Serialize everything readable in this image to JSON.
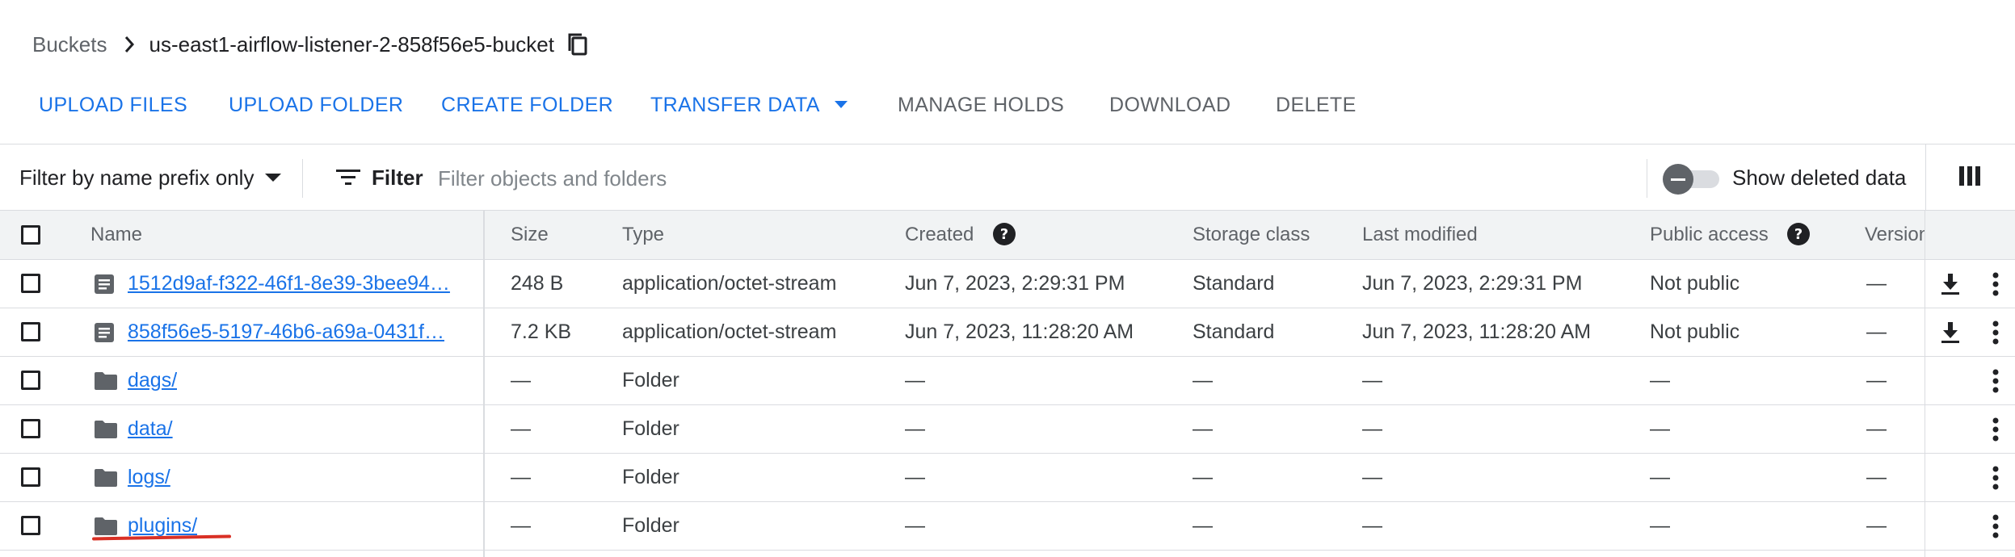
{
  "breadcrumb": {
    "root": "Buckets",
    "current": "us-east1-airflow-listener-2-858f56e5-bucket"
  },
  "toolbar": {
    "upload_files": "UPLOAD FILES",
    "upload_folder": "UPLOAD FOLDER",
    "create_folder": "CREATE FOLDER",
    "transfer_data": "TRANSFER DATA",
    "manage_holds": "MANAGE HOLDS",
    "download": "DOWNLOAD",
    "delete": "DELETE"
  },
  "filterbar": {
    "prefix_label": "Filter by name prefix only",
    "filter_label": "Filter",
    "filter_placeholder": "Filter objects and folders",
    "show_deleted_label": "Show deleted data"
  },
  "table": {
    "headers": {
      "name": "Name",
      "size": "Size",
      "type": "Type",
      "created": "Created",
      "storage_class": "Storage class",
      "last_modified": "Last modified",
      "public_access": "Public access",
      "version": "Version"
    },
    "rows": [
      {
        "name": "1512d9af-f322-46f1-8e39-3bee94…",
        "kind": "file",
        "size": "248 B",
        "type": "application/octet-stream",
        "created": "Jun 7, 2023, 2:29:31 PM",
        "storage_class": "Standard",
        "last_modified": "Jun 7, 2023, 2:29:31 PM",
        "public_access": "Not public",
        "version": "—"
      },
      {
        "name": "858f56e5-5197-46b6-a69a-0431f…",
        "kind": "file",
        "size": "7.2 KB",
        "type": "application/octet-stream",
        "created": "Jun 7, 2023, 11:28:20 AM",
        "storage_class": "Standard",
        "last_modified": "Jun 7, 2023, 11:28:20 AM",
        "public_access": "Not public",
        "version": "—"
      },
      {
        "name": "dags/",
        "kind": "folder",
        "size": "—",
        "type": "Folder",
        "created": "—",
        "storage_class": "—",
        "last_modified": "—",
        "public_access": "—",
        "version": "—"
      },
      {
        "name": "data/",
        "kind": "folder",
        "size": "—",
        "type": "Folder",
        "created": "—",
        "storage_class": "—",
        "last_modified": "—",
        "public_access": "—",
        "version": "—"
      },
      {
        "name": "logs/",
        "kind": "folder",
        "size": "—",
        "type": "Folder",
        "created": "—",
        "storage_class": "—",
        "last_modified": "—",
        "public_access": "—",
        "version": "—"
      },
      {
        "name": "plugins/",
        "kind": "folder",
        "size": "—",
        "type": "Folder",
        "created": "—",
        "storage_class": "—",
        "last_modified": "—",
        "public_access": "—",
        "version": "—"
      }
    ]
  },
  "colors": {
    "accent": "#1a73e8",
    "text_secondary": "#5f6368",
    "annotation_red": "#d93025"
  },
  "icons": {
    "breadcrumb_separator": "chevron-right-icon",
    "copy": "copy-icon",
    "filter": "filter-list-icon",
    "columns": "view-columns-icon",
    "help": "help-icon",
    "file": "file-icon",
    "folder": "folder-icon",
    "download": "download-icon",
    "more": "more-vert-icon"
  }
}
